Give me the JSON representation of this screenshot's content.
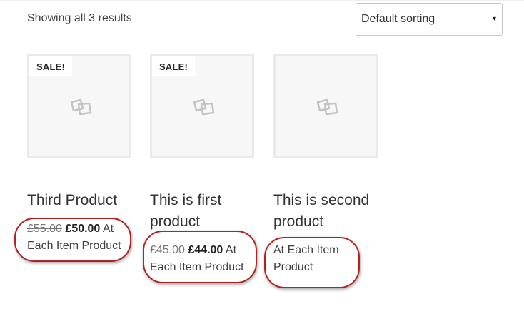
{
  "shop": {
    "result_count": "Showing all 3 results",
    "sorting": {
      "selected": "Default sorting",
      "caret": "▾"
    }
  },
  "products": [
    {
      "title": "Third Product",
      "on_sale": true,
      "sale_badge": "SALE!",
      "regular_price": "£55.00",
      "sale_price": "£50.00",
      "price_suffix": " At Each Item Product"
    },
    {
      "title": "This is first product",
      "on_sale": true,
      "sale_badge": "SALE!",
      "regular_price": "£45.00",
      "sale_price": "£44.00",
      "price_suffix": " At Each Item Product"
    },
    {
      "title": "This is second product",
      "on_sale": false,
      "price_suffix": "At Each Item Product"
    }
  ],
  "annotation_color": "#b22222"
}
